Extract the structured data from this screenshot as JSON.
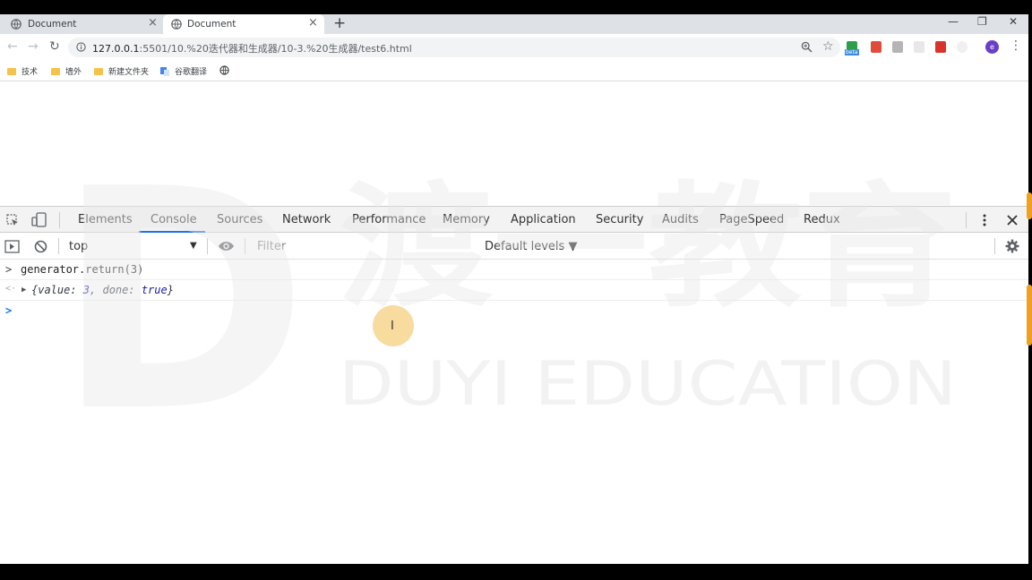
{
  "browser": {
    "tabs": [
      {
        "title": "Document",
        "active": false
      },
      {
        "title": "Document",
        "active": true
      }
    ],
    "new_tab_glyph": "+",
    "close_glyph": "×",
    "window_controls": {
      "minimize": "—",
      "restore": "❐",
      "close": "✕"
    },
    "nav": {
      "back": "←",
      "forward": "→",
      "reload": "↻"
    },
    "url_host": "127.0.0.1",
    "url_rest": ":5501/10.%20迭代器和生成器/10-3.%20生成器/test6.html",
    "star_glyph": "☆",
    "menu_glyph": "⋮",
    "ext_badge": "beta",
    "avatar_letter": "e",
    "bookmarks": [
      {
        "label": "技术",
        "icon": "folder-icon"
      },
      {
        "label": "墙外",
        "icon": "folder-icon"
      },
      {
        "label": "新建文件夹",
        "icon": "folder-icon"
      },
      {
        "label": "谷歌翻译",
        "icon": "google-translate-icon"
      },
      {
        "label": "",
        "icon": "globe-icon"
      }
    ]
  },
  "watermark": {
    "brand_cn": "渡一教育",
    "brand_en": "DUYI EDUCATION",
    "logo_letter": "D"
  },
  "devtools": {
    "tabs": [
      "Elements",
      "Console",
      "Sources",
      "Network",
      "Performance",
      "Memory",
      "Application",
      "Security",
      "Audits",
      "PageSpeed",
      "Redux"
    ],
    "active_tab": "Console",
    "context": "top",
    "filter_placeholder": "Filter",
    "levels": "Default levels ▼",
    "console": {
      "input_prompt": ">",
      "output_prompt": "<·",
      "command": "generator.return(3)",
      "result": {
        "open": "{value: ",
        "value": "3",
        "mid": ", done: ",
        "done": "true",
        "close": "}"
      },
      "expand_glyph": "▶",
      "active_prompt": ">"
    }
  },
  "colors": {
    "accent": "#1a73e8",
    "chrome_bg": "#dee1e6",
    "devtools_bar": "#f3f3f3",
    "cursor_highlight": "#f0be50"
  }
}
